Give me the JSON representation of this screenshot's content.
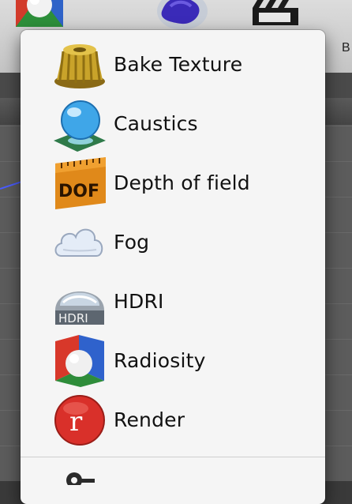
{
  "background_app": {
    "toolbar_partial_label": "B",
    "toolbar_icons": [
      "material-sphere-icon",
      "sculpt-blob-icon",
      "clapperboard-icon"
    ]
  },
  "menu": {
    "items": [
      {
        "label": "Bake Texture",
        "icon": "bundt-cake-icon"
      },
      {
        "label": "Caustics",
        "icon": "glass-sphere-icon"
      },
      {
        "label": "Depth of field",
        "icon": "dof-ruler-icon"
      },
      {
        "label": "Fog",
        "icon": "cloud-icon"
      },
      {
        "label": "HDRI",
        "icon": "hdri-dome-icon"
      },
      {
        "label": "Radiosity",
        "icon": "radiosity-cube-icon"
      },
      {
        "label": "Render",
        "icon": "render-r-icon"
      }
    ],
    "partial_item_icon": "key-icon"
  },
  "colors": {
    "menu_background": "#f5f5f5",
    "label_text": "#111111",
    "viewport_background": "#5c5c5c"
  }
}
